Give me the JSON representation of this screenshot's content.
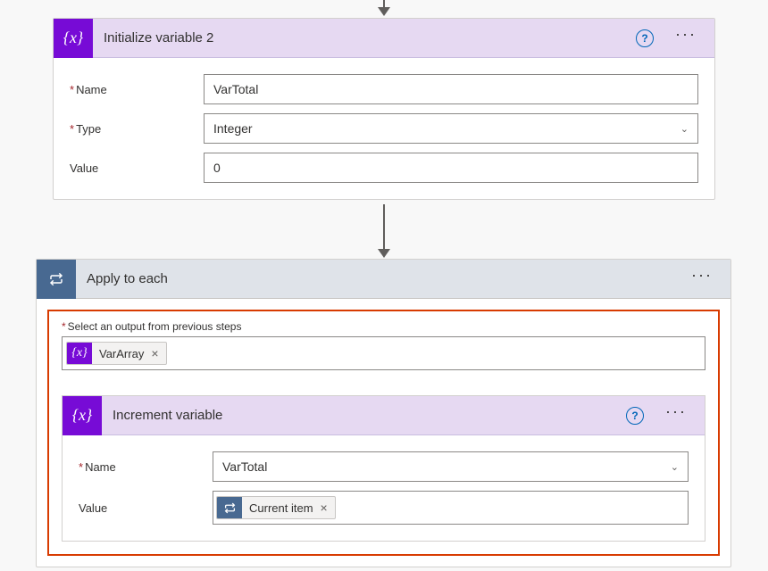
{
  "card1": {
    "title": "Initialize variable 2",
    "name_label": "Name",
    "type_label": "Type",
    "value_label": "Value",
    "name_value": "VarTotal",
    "type_value": "Integer",
    "value_value": "0"
  },
  "apply": {
    "title": "Apply to each",
    "select_label": "Select an output from previous steps",
    "token_label": "VarArray"
  },
  "inner": {
    "title": "Increment variable",
    "name_label": "Name",
    "value_label": "Value",
    "name_value": "VarTotal",
    "token_label": "Current item"
  },
  "glyphs": {
    "fx": "{x}",
    "help": "?",
    "dots": "···",
    "chev": "⌄",
    "x": "×"
  }
}
